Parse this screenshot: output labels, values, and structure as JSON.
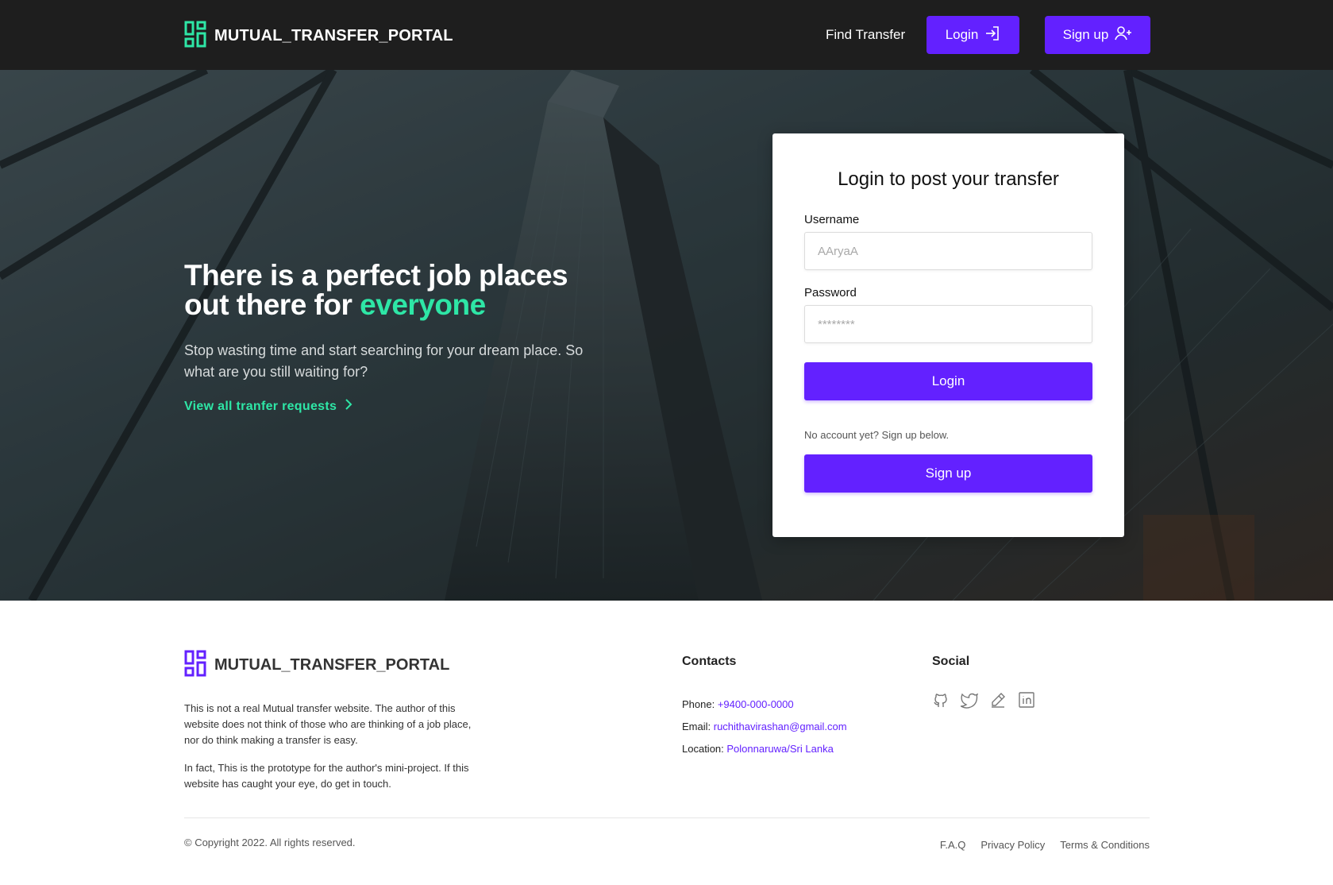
{
  "nav": {
    "brand": "MUTUAL_TRANSFER_PORTAL",
    "find_transfer": "Find Transfer",
    "login": "Login",
    "signup": "Sign up"
  },
  "hero": {
    "title_line1": "There is a perfect job places",
    "title_line2_prefix": "out there for ",
    "title_accent": "everyone",
    "subtitle": "Stop wasting time and start searching for your dream place. So what are you still waiting for?",
    "link": "View all tranfer requests"
  },
  "login_card": {
    "title": "Login to post your transfer",
    "username_label": "Username",
    "username_placeholder": "AAryaA",
    "password_label": "Password",
    "password_placeholder": "********",
    "login_button": "Login",
    "note": "No account yet? Sign up below.",
    "signup_button": "Sign up"
  },
  "footer": {
    "brand": "MUTUAL_TRANSFER_PORTAL",
    "about_p1": "This is not a real Mutual transfer website. The author of this website does not think of those who are thinking of a job place, nor do think making a transfer is easy.",
    "about_p2": "In fact, This is the prototype for the author's mini-project. If this website has caught your eye, do get in touch.",
    "contacts_title": "Contacts",
    "phone_label": "Phone:",
    "phone": "+9400-000-0000",
    "email_label": "Email:",
    "email": "ruchithavirashan@gmail.com",
    "location_label": "Location:",
    "location": "Polonnaruwa/Sri Lanka",
    "social_title": "Social",
    "social_icons": [
      "github-icon",
      "twitter-icon",
      "pencil-icon",
      "linkedin-icon"
    ],
    "copyright": "© Copyright 2022. All rights reserved.",
    "links": [
      "F.A.Q",
      "Privacy Policy",
      "Terms & Conditions"
    ]
  },
  "colors": {
    "accent": "#6321ff",
    "highlight": "#2ee6a6",
    "navbar": "#1e1e1e"
  }
}
